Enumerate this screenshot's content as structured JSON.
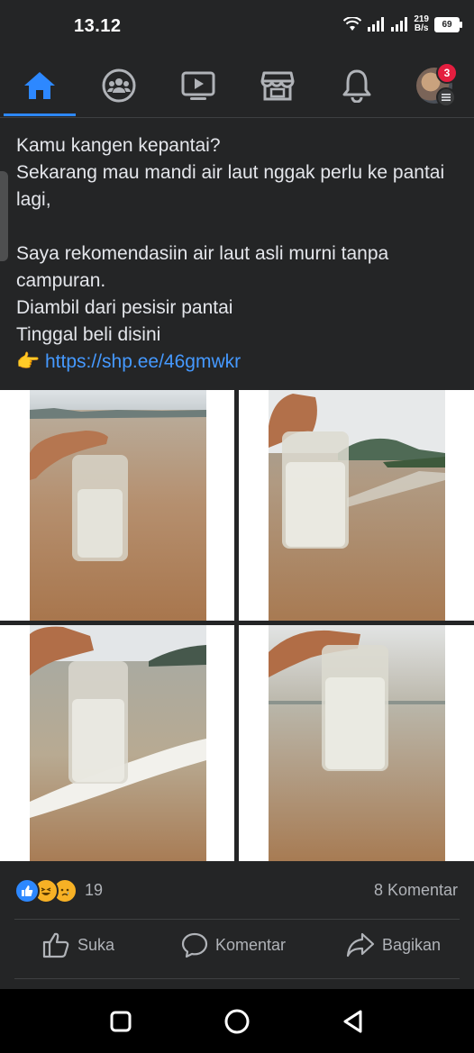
{
  "status_bar": {
    "time": "13.12",
    "net_speed_value": "219",
    "net_speed_unit": "B/s",
    "battery": "69"
  },
  "nav": {
    "items": [
      "home-icon",
      "groups-icon",
      "watch-icon",
      "marketplace-icon",
      "notifications-icon",
      "profile-menu"
    ],
    "active": "home",
    "notification_badge": "3",
    "accent": "#2d88ff"
  },
  "post": {
    "text": "Kamu kangen kepantai?\nSekarang mau mandi air laut nggak perlu ke pantai lagi,\n\nSaya rekomendasiin air laut asli murni tanpa campuran.\nDiambil dari pesisir pantai\nTinggal beli disini",
    "pointer_emoji": "👉",
    "link": "https://shp.ee/46gmwkr"
  },
  "reactions": {
    "count": "19",
    "comments": "8 Komentar"
  },
  "actions": {
    "like": "Suka",
    "comment": "Komentar",
    "share": "Bagikan"
  }
}
